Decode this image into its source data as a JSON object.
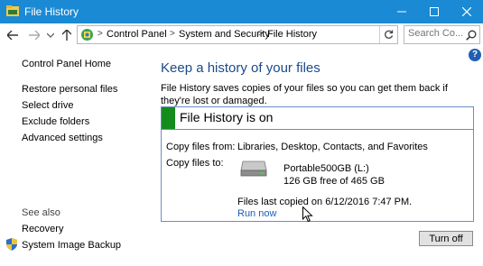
{
  "window": {
    "title": "File History",
    "app_icon": "file-history-icon"
  },
  "titlebar_buttons": {
    "minimize": "minimize-icon",
    "maximize": "maximize-icon",
    "close": "close-icon"
  },
  "nav": {
    "back": "back-arrow-icon",
    "forward": "forward-arrow-icon",
    "recent": "chevron-down-icon",
    "up": "up-arrow-icon"
  },
  "breadcrumb": {
    "items": [
      "Control Panel",
      "System and Security",
      "File History"
    ],
    "separator": ">"
  },
  "search": {
    "placeholder": "Search Co..."
  },
  "sidebar": {
    "items": [
      "Control Panel Home",
      "Restore personal files",
      "Select drive",
      "Exclude folders",
      "Advanced settings"
    ],
    "see_also_label": "See also",
    "see_also": [
      "Recovery",
      "System Image Backup"
    ]
  },
  "main": {
    "heading": "Keep a history of your files",
    "description": "File History saves copies of your files so you can get them back if they're lost or damaged.",
    "status_title": "File History is on",
    "copy_from_label": "Copy files from:",
    "copy_from_value": "Libraries, Desktop, Contacts, and Favorites",
    "copy_to_label": "Copy files to:",
    "drive_name": "Portable500GB (L:)",
    "drive_space": "126 GB free of 465 GB",
    "last_copied": "Files last copied on 6/12/2016 7:47 PM.",
    "run_now": "Run now",
    "turn_off": "Turn off"
  },
  "colors": {
    "titlebar": "#1a8ad4",
    "status_green": "#138b1d",
    "heading_blue": "#1a4a8a",
    "link_blue": "#1a5fb4"
  }
}
